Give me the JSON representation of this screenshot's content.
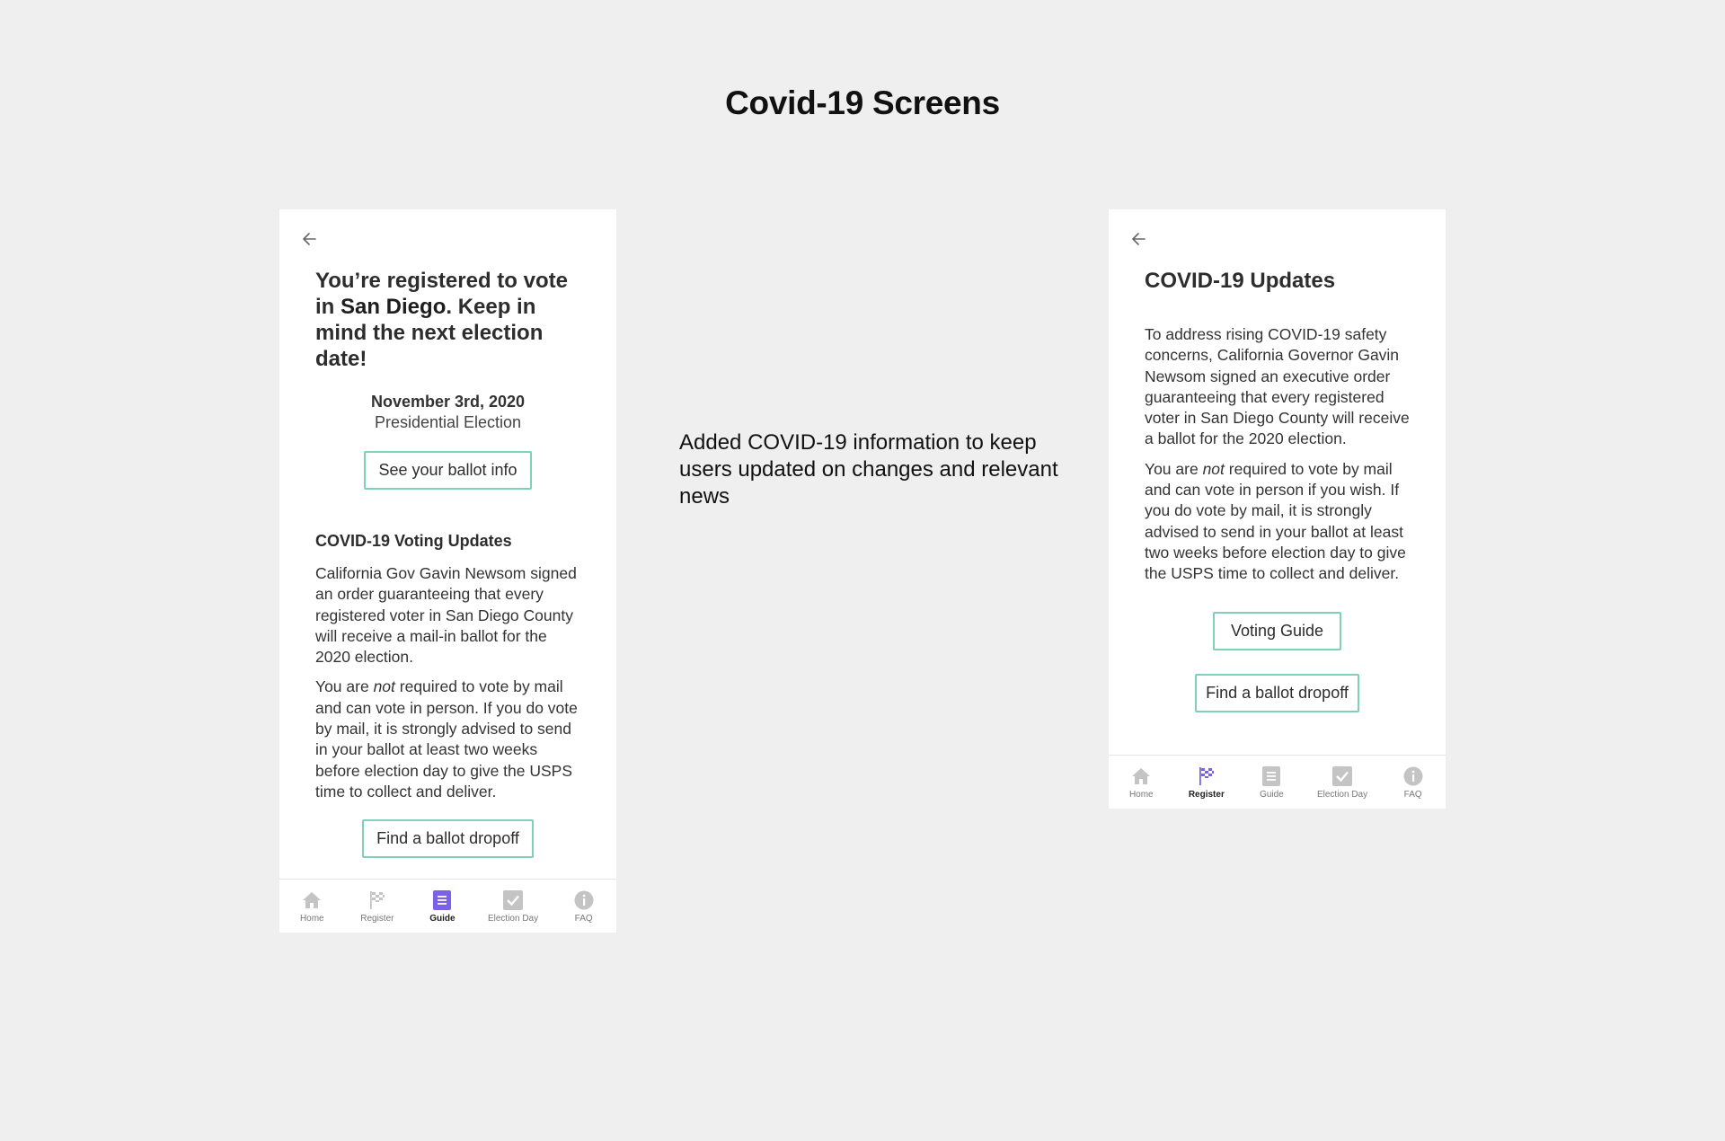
{
  "page": {
    "title": "Covid-19 Screens"
  },
  "note": {
    "text": "Added COVID-19 information to keep users updated on changes and relevant news"
  },
  "left_screen": {
    "headline_prefix": "You’re registered to vote in ",
    "headline_city": "San Diego",
    "headline_suffix": ". Keep in mind the next election date!",
    "date": "November 3rd, 2020",
    "election": "Presidential Election",
    "ballot_button": "See your ballot info",
    "section_title": "COVID-19 Voting Updates",
    "para1": "California Gov Gavin Newsom signed an order guaranteeing that every registered voter in San Diego County will receive a mail-in ballot for the 2020 election.",
    "para2_pre": "You are ",
    "para2_em": "not",
    "para2_post": " required to vote by mail and can vote in person. If you do vote by mail, it is strongly advised to send in your ballot at least two weeks before election day to give the USPS time to collect and deliver.",
    "dropoff_button": "Find a ballot dropoff",
    "tabs": [
      {
        "label": "Home",
        "icon": "home-icon"
      },
      {
        "label": "Register",
        "icon": "flag-icon"
      },
      {
        "label": "Guide",
        "icon": "guide-icon",
        "active": true
      },
      {
        "label": "Election Day",
        "icon": "check-icon"
      },
      {
        "label": "FAQ",
        "icon": "info-icon"
      }
    ]
  },
  "right_screen": {
    "title": "COVID-19 Updates",
    "para1": "To address rising COVID-19 safety concerns, California Governor Gavin Newsom signed an executive order guaranteeing that every registered voter in San Diego County will receive a ballot for the 2020 election.",
    "para2_pre": "You are ",
    "para2_em": "not",
    "para2_post": " required to vote by mail and can vote in person if you wish. If you do vote by mail, it is strongly advised to send in your ballot at least two weeks before election day to give the USPS time to collect and deliver.",
    "guide_button": "Voting Guide",
    "dropoff_button": "Find a ballot dropoff",
    "tabs": [
      {
        "label": "Home",
        "icon": "home-icon"
      },
      {
        "label": "Register",
        "icon": "flag-icon",
        "active": true
      },
      {
        "label": "Guide",
        "icon": "guide-icon"
      },
      {
        "label": "Election Day",
        "icon": "check-icon"
      },
      {
        "label": "FAQ",
        "icon": "info-icon"
      }
    ]
  },
  "colors": {
    "accent_green": "#5fc9a6",
    "button_border": "#7fd0b8",
    "active_purple": "#7b61e8",
    "inactive_icon": "#c4c4c4",
    "background": "#efefef"
  }
}
